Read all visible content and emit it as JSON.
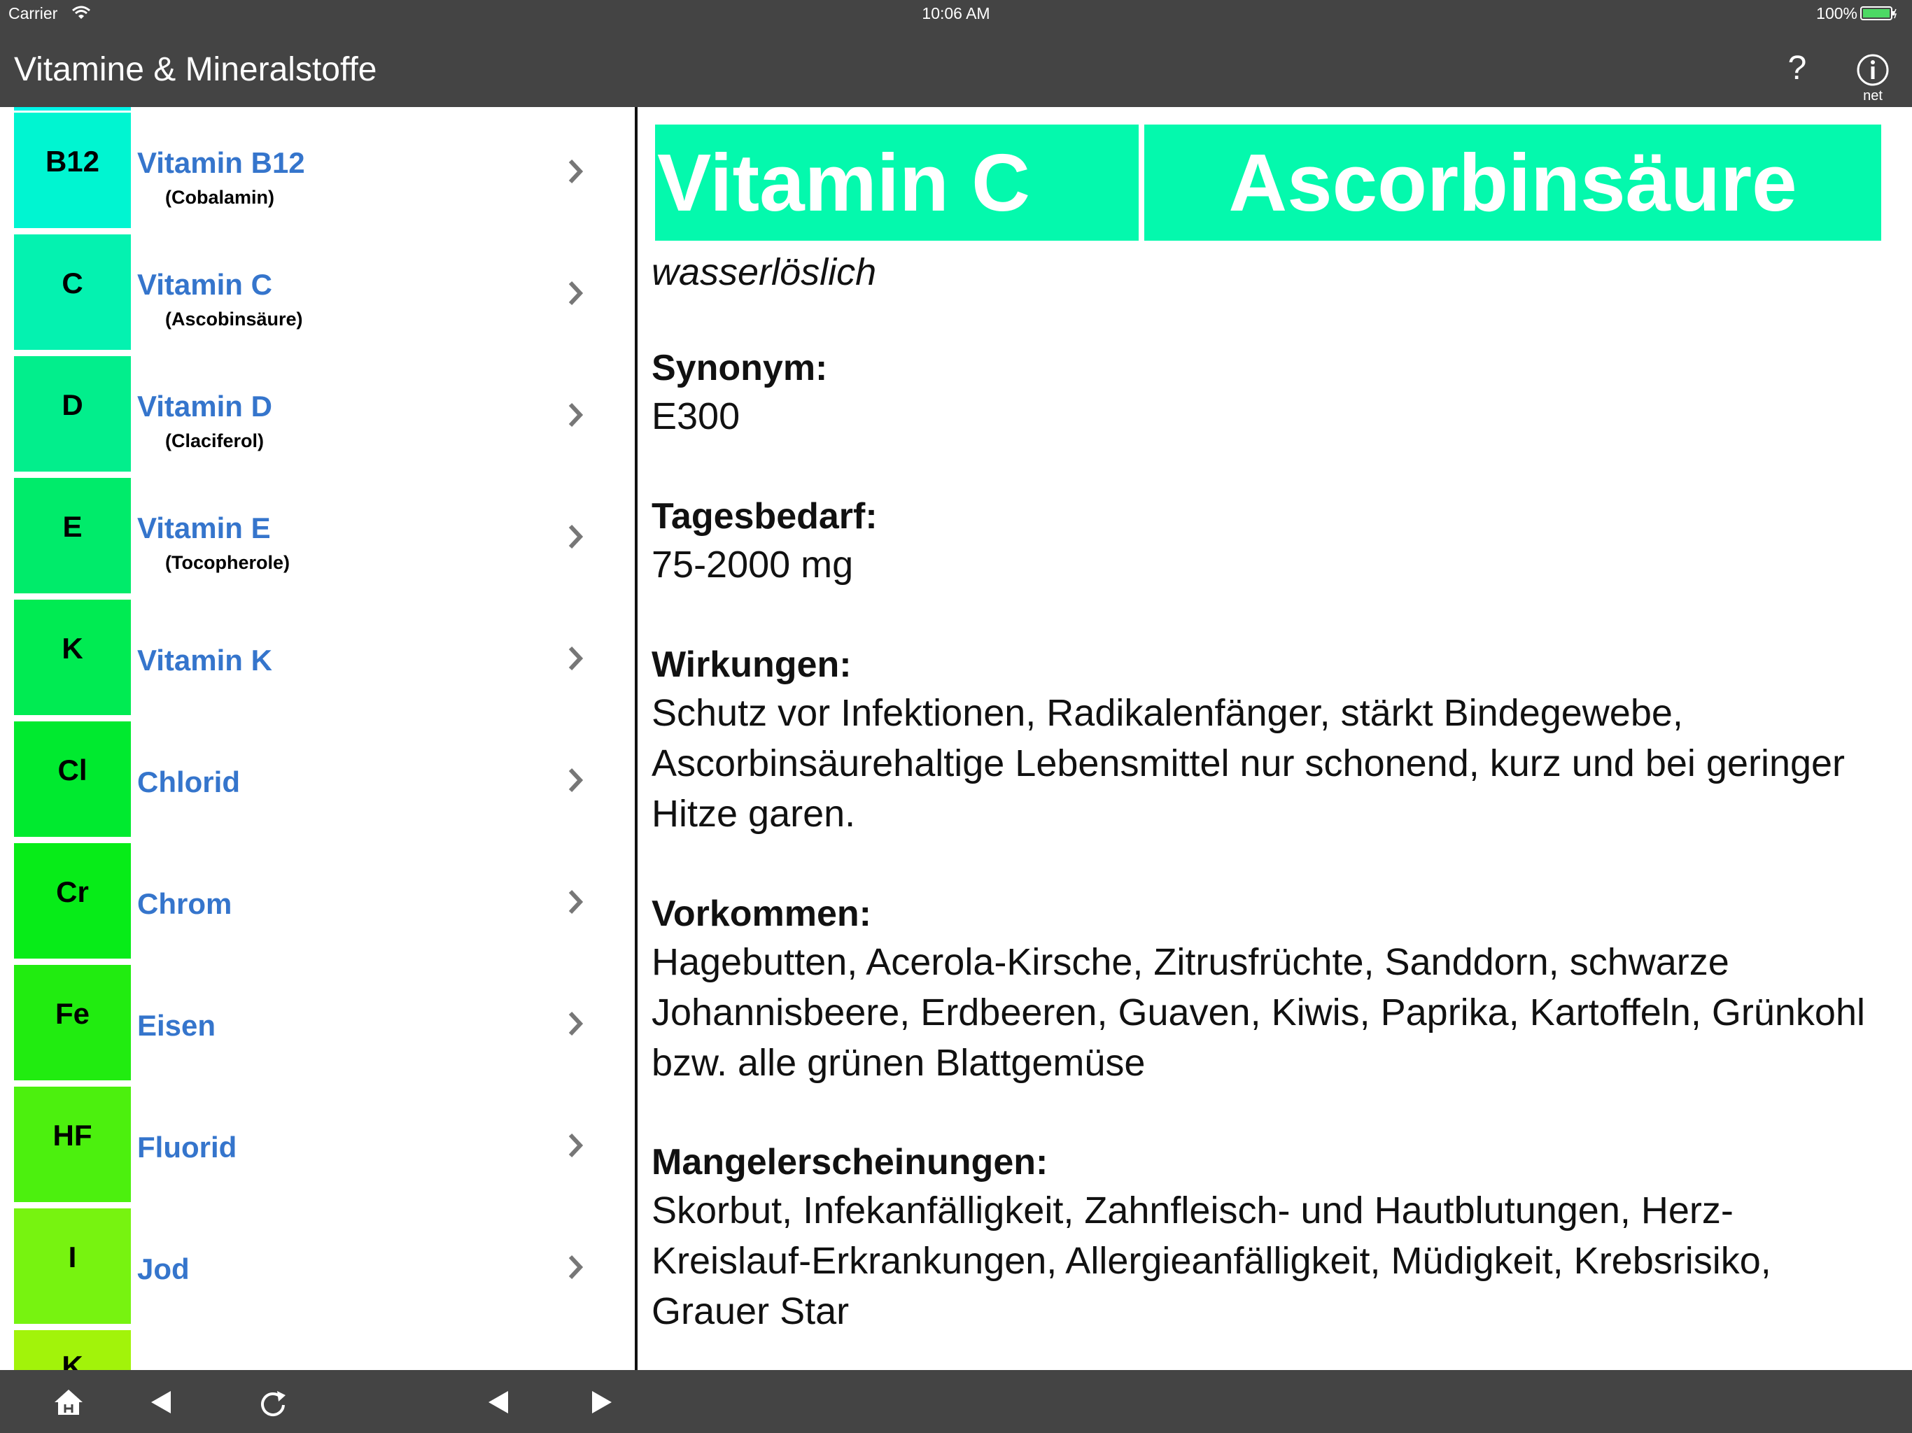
{
  "status": {
    "carrier": "Carrier",
    "time": "10:06 AM",
    "battery": "100%"
  },
  "nav": {
    "title": "Vitamine & Mineralstoffe",
    "help": "?",
    "info_label": "net"
  },
  "list": [
    {
      "symbol": "B12",
      "name": "Vitamin B12",
      "sub": "(Cobalamin)",
      "color": "#00f5d1"
    },
    {
      "symbol": "C",
      "name": "Vitamin C",
      "sub": "(Ascobinsäure)",
      "color": "#04f2b0"
    },
    {
      "symbol": "D",
      "name": "Vitamin D",
      "sub": "(Claciferol)",
      "color": "#02ee8c"
    },
    {
      "symbol": "E",
      "name": "Vitamin E",
      "sub": "(Tocopherole)",
      "color": "#00eb6a"
    },
    {
      "symbol": "K",
      "name": "Vitamin K",
      "sub": "",
      "color": "#00eb52"
    },
    {
      "symbol": "Cl",
      "name": "Chlorid",
      "sub": "",
      "color": "#00ea2f"
    },
    {
      "symbol": "Cr",
      "name": "Chrom",
      "sub": "",
      "color": "#07ec18"
    },
    {
      "symbol": "Fe",
      "name": "Eisen",
      "sub": "",
      "color": "#21ec10"
    },
    {
      "symbol": "HF",
      "name": "Fluorid",
      "sub": "",
      "color": "#4cf00e"
    },
    {
      "symbol": "I",
      "name": "Jod",
      "sub": "",
      "color": "#77f310"
    },
    {
      "symbol": "K",
      "name": "",
      "sub": "",
      "color": "#a2f30a"
    }
  ],
  "detail": {
    "name": "Vitamin C",
    "chemical": "Ascorbinsäure",
    "header_color": "#04f9ad",
    "solubility": "wasserlöslich",
    "synonym_label": "Synonym:",
    "synonym": "E300",
    "daily_label": "Tagesbedarf:",
    "daily": "75-2000 mg",
    "effects_label": "Wirkungen:",
    "effects": "Schutz vor Infektionen, Radikalenfänger, stärkt Bindegewebe, Ascorbinsäurehaltige Lebensmittel nur schonend, kurz und bei geringer Hitze garen.",
    "occurrence_label": "Vorkommen:",
    "occurrence": "Hagebutten, Acerola-Kirsche, Zitrusfrüchte, Sanddorn, schwarze Johannisbeere, Erdbeeren, Guaven, Kiwis, Paprika, Kartoffeln, Grünkohl bzw. alle grünen Blattgemüse",
    "deficiency_label": "Mangelerscheinungen:",
    "deficiency": "Skorbut, Infekanfälligkeit, Zahnfleisch- und Hautblutungen, Herz-Kreislauf-Erkrankungen, Allergieanfälligkeit, Müdigkeit, Krebsrisiko, Grauer Star"
  },
  "toolbar": {
    "home_icon": "home-icon",
    "back_icon": "triangle-left-icon",
    "reload_icon": "reload-icon",
    "prev_icon": "triangle-left-icon",
    "next_icon": "triangle-right-icon"
  }
}
